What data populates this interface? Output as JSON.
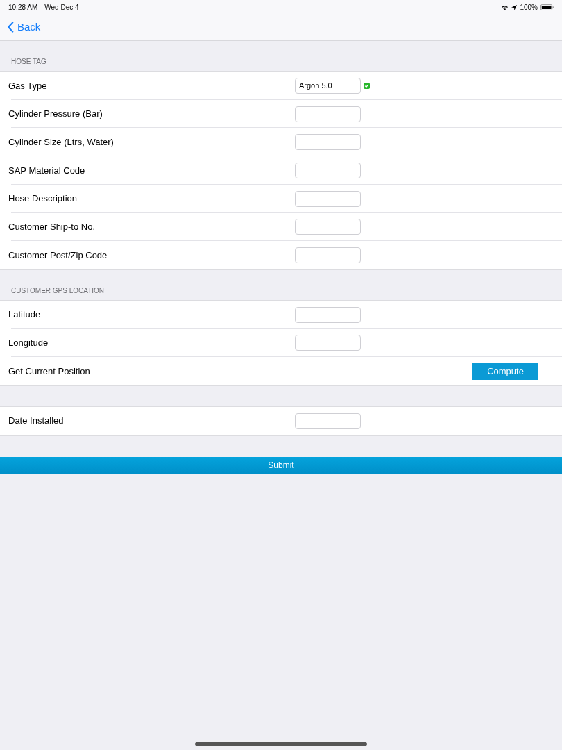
{
  "status_bar": {
    "time": "10:28 AM",
    "date": "Wed Dec 4",
    "battery": "100%"
  },
  "nav": {
    "back": "Back"
  },
  "sections": [
    {
      "header": "HOSE TAG",
      "rows": [
        {
          "kind": "field",
          "label": "Gas Type",
          "value": "Argon 5.0",
          "checked": true
        },
        {
          "kind": "field",
          "label": "Cylinder Pressure (Bar)"
        },
        {
          "kind": "field",
          "label": "Cylinder Size (Ltrs, Water)"
        },
        {
          "kind": "field",
          "label": "SAP Material Code"
        },
        {
          "kind": "field",
          "label": "Hose Description"
        },
        {
          "kind": "field",
          "label": "Customer Ship-to No."
        },
        {
          "kind": "field",
          "label": "Customer Post/Zip Code"
        }
      ]
    },
    {
      "header": "CUSTOMER GPS LOCATION",
      "rows": [
        {
          "kind": "field",
          "label": "Latitude"
        },
        {
          "kind": "field",
          "label": "Longitude"
        },
        {
          "kind": "button",
          "label": "Get Current Position",
          "button": "Compute"
        }
      ]
    },
    {
      "rows": [
        {
          "kind": "field",
          "label": "Date Installed"
        }
      ]
    }
  ],
  "submit": "Submit"
}
